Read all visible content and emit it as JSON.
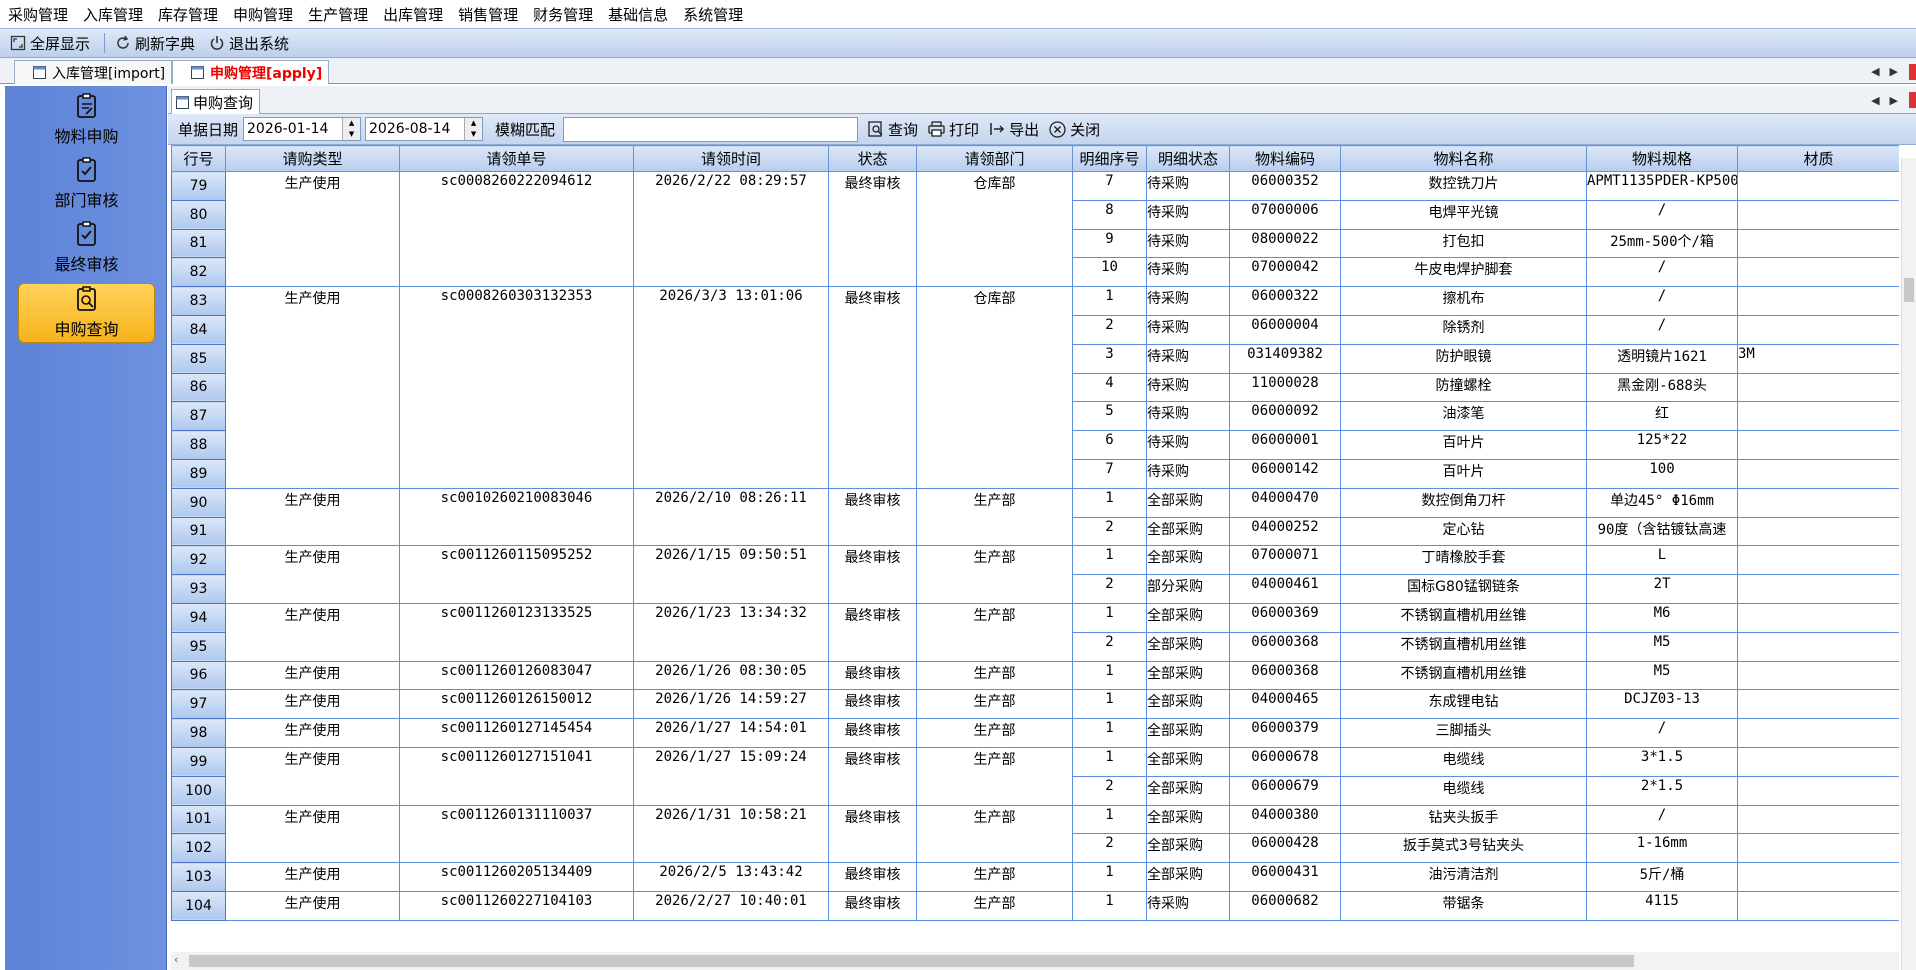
{
  "menu": [
    "采购管理",
    "入库管理",
    "库存管理",
    "申购管理",
    "生产管理",
    "出库管理",
    "销售管理",
    "财务管理",
    "基础信息",
    "系统管理"
  ],
  "toolbar": {
    "fullscreen": "全屏显示",
    "refresh": "刷新字典",
    "exit": "退出系统"
  },
  "tabs": [
    {
      "label": "入库管理[import]",
      "active": false
    },
    {
      "label": "申购管理[apply]",
      "active": true
    }
  ],
  "sidebar": [
    {
      "label": "物料申购",
      "icon": "clipboard-edit-icon"
    },
    {
      "label": "部门审核",
      "icon": "clipboard-check-icon"
    },
    {
      "label": "最终审核",
      "icon": "clipboard-check-icon"
    },
    {
      "label": "申购查询",
      "icon": "clipboard-search-icon",
      "active": true
    }
  ],
  "subtab": "申购查询",
  "filter": {
    "date_label": "单据日期",
    "date_from": "2026-01-14",
    "date_to": "2026-08-14",
    "fuzzy_label": "模糊匹配",
    "fuzzy_value": "",
    "query": "查询",
    "print": "打印",
    "export": "导出",
    "close": "关闭"
  },
  "columns": [
    "行号",
    "请购类型",
    "请领单号",
    "请领时间",
    "状态",
    "请领部门",
    "明细序号",
    "明细状态",
    "物料编码",
    "物料名称",
    "物料规格",
    "材质"
  ],
  "groups": [
    {
      "type": "生产使用",
      "no": "sc0008260222094612",
      "time": "2026/2/22 08:29:57",
      "status": "最终审核",
      "dept": "仓库部",
      "rows": [
        [
          79,
          "7",
          "待采购",
          "06000352",
          "数控铣刀片",
          "APMT1135PDER-KP500",
          ""
        ],
        [
          80,
          "8",
          "待采购",
          "07000006",
          "电焊平光镜",
          "/",
          ""
        ],
        [
          81,
          "9",
          "待采购",
          "08000022",
          "打包扣",
          "25mm-500个/箱",
          ""
        ],
        [
          82,
          "10",
          "待采购",
          "07000042",
          "牛皮电焊护脚套",
          "/",
          ""
        ]
      ]
    },
    {
      "type": "生产使用",
      "no": "sc0008260303132353",
      "time": "2026/3/3 13:01:06",
      "status": "最终审核",
      "dept": "仓库部",
      "rows": [
        [
          83,
          "1",
          "待采购",
          "06000322",
          "擦机布",
          "/",
          ""
        ],
        [
          84,
          "2",
          "待采购",
          "06000004",
          "除锈剂",
          "/",
          ""
        ],
        [
          85,
          "3",
          "待采购",
          "031409382",
          "防护眼镜",
          "透明镜片1621",
          "3M"
        ],
        [
          86,
          "4",
          "待采购",
          "11000028",
          "防撞螺栓",
          "黑金刚-688头",
          ""
        ],
        [
          87,
          "5",
          "待采购",
          "06000092",
          "油漆笔",
          "红",
          ""
        ],
        [
          88,
          "6",
          "待采购",
          "06000001",
          "百叶片",
          "125*22",
          ""
        ],
        [
          89,
          "7",
          "待采购",
          "06000142",
          "百叶片",
          "100",
          ""
        ]
      ]
    },
    {
      "type": "生产使用",
      "no": "sc0010260210083046",
      "time": "2026/2/10 08:26:11",
      "status": "最终审核",
      "dept": "生产部",
      "rows": [
        [
          90,
          "1",
          "全部采购",
          "04000470",
          "数控倒角刀杆",
          "单边45° Φ16mm",
          ""
        ],
        [
          91,
          "2",
          "全部采购",
          "04000252",
          "定心钻",
          "90度（含钴镀钛高速",
          ""
        ]
      ]
    },
    {
      "type": "生产使用",
      "no": "sc0011260115095252",
      "time": "2026/1/15 09:50:51",
      "status": "最终审核",
      "dept": "生产部",
      "rows": [
        [
          92,
          "1",
          "全部采购",
          "07000071",
          "丁晴橡胶手套",
          "L",
          ""
        ],
        [
          93,
          "2",
          "部分采购",
          "04000461",
          "国标G80锰钢链条",
          "2T",
          ""
        ]
      ]
    },
    {
      "type": "生产使用",
      "no": "sc0011260123133525",
      "time": "2026/1/23 13:34:32",
      "status": "最终审核",
      "dept": "生产部",
      "rows": [
        [
          94,
          "1",
          "全部采购",
          "06000369",
          "不锈钢直槽机用丝锥",
          "M6",
          ""
        ],
        [
          95,
          "2",
          "全部采购",
          "06000368",
          "不锈钢直槽机用丝锥",
          "M5",
          ""
        ]
      ]
    },
    {
      "type": "生产使用",
      "no": "sc0011260126083047",
      "time": "2026/1/26 08:30:05",
      "status": "最终审核",
      "dept": "生产部",
      "rows": [
        [
          96,
          "1",
          "全部采购",
          "06000368",
          "不锈钢直槽机用丝锥",
          "M5",
          ""
        ]
      ]
    },
    {
      "type": "生产使用",
      "no": "sc0011260126150012",
      "time": "2026/1/26 14:59:27",
      "status": "最终审核",
      "dept": "生产部",
      "rows": [
        [
          97,
          "1",
          "全部采购",
          "04000465",
          "东成锂电钻",
          "DCJZ03-13",
          ""
        ]
      ]
    },
    {
      "type": "生产使用",
      "no": "sc0011260127145454",
      "time": "2026/1/27 14:54:01",
      "status": "最终审核",
      "dept": "生产部",
      "rows": [
        [
          98,
          "1",
          "全部采购",
          "06000379",
          "三脚插头",
          "/",
          ""
        ]
      ]
    },
    {
      "type": "生产使用",
      "no": "sc0011260127151041",
      "time": "2026/1/27 15:09:24",
      "status": "最终审核",
      "dept": "生产部",
      "rows": [
        [
          99,
          "1",
          "全部采购",
          "06000678",
          "电缆线",
          "3*1.5",
          ""
        ],
        [
          100,
          "2",
          "全部采购",
          "06000679",
          "电缆线",
          "2*1.5",
          ""
        ]
      ]
    },
    {
      "type": "生产使用",
      "no": "sc0011260131110037",
      "time": "2026/1/31 10:58:21",
      "status": "最终审核",
      "dept": "生产部",
      "rows": [
        [
          101,
          "1",
          "全部采购",
          "04000380",
          "钻夹头扳手",
          "/",
          ""
        ],
        [
          102,
          "2",
          "全部采购",
          "06000428",
          "扳手莫式3号钻夹头",
          "1-16mm",
          ""
        ]
      ]
    },
    {
      "type": "生产使用",
      "no": "sc0011260205134409",
      "time": "2026/2/5 13:43:42",
      "status": "最终审核",
      "dept": "生产部",
      "rows": [
        [
          103,
          "1",
          "全部采购",
          "06000431",
          "油污清洁剂",
          "5斤/桶",
          ""
        ]
      ]
    },
    {
      "type": "生产使用",
      "no": "sc0011260227104103",
      "time": "2026/2/27 10:40:01",
      "status": "最终审核",
      "dept": "生产部",
      "rows": [
        [
          104,
          "1",
          "待采购",
          "06000682",
          "带锯条",
          "4115",
          ""
        ]
      ]
    }
  ]
}
